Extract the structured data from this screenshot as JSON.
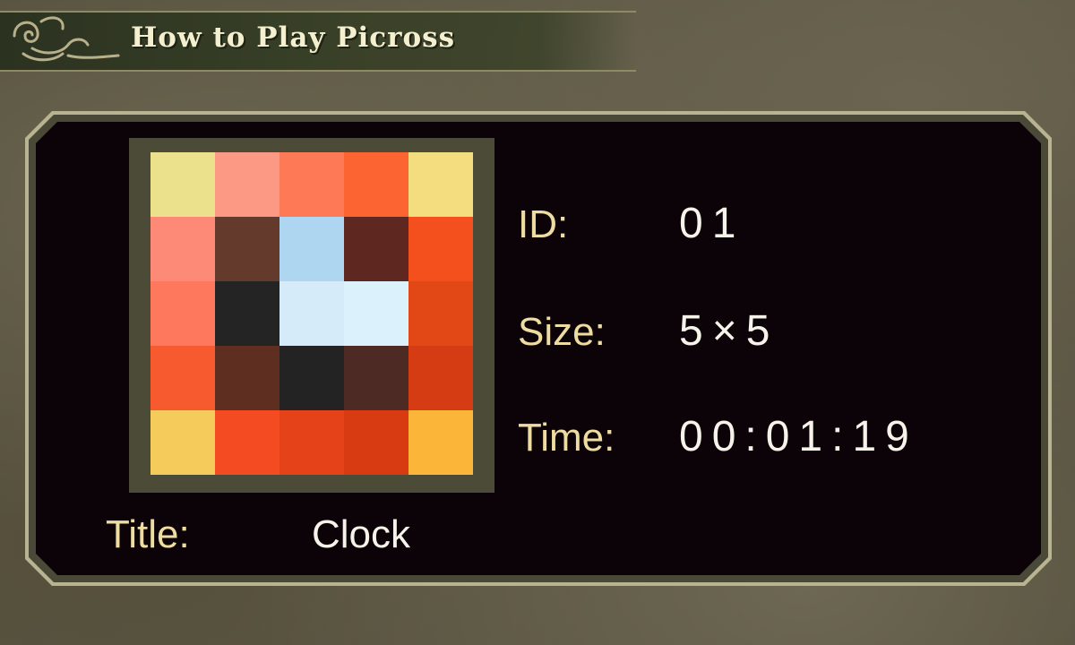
{
  "header": {
    "title": "How to Play Picross"
  },
  "puzzle": {
    "cells": [
      "#ebe08c",
      "#fc9985",
      "#fe7a56",
      "#fc6432",
      "#f4dd7e",
      "#fd8a77",
      "#643a2c",
      "#aed6f1",
      "#5e2820",
      "#f3501e",
      "#fd785c",
      "#242424",
      "#d6ebf9",
      "#dbf2fd",
      "#e24816",
      "#f65a2e",
      "#5e2f21",
      "#232323",
      "#4d2a24",
      "#d63c14",
      "#f5cb5c",
      "#f44b22",
      "#e6421a",
      "#d83a12",
      "#fbb63a"
    ]
  },
  "info": {
    "id_label": "ID:",
    "id_value": "01",
    "size_label": "Size:",
    "size_value": "5×5",
    "time_label": "Time:",
    "time_value": "00:01:19",
    "title_label": "Title:",
    "title_value": "Clock"
  }
}
